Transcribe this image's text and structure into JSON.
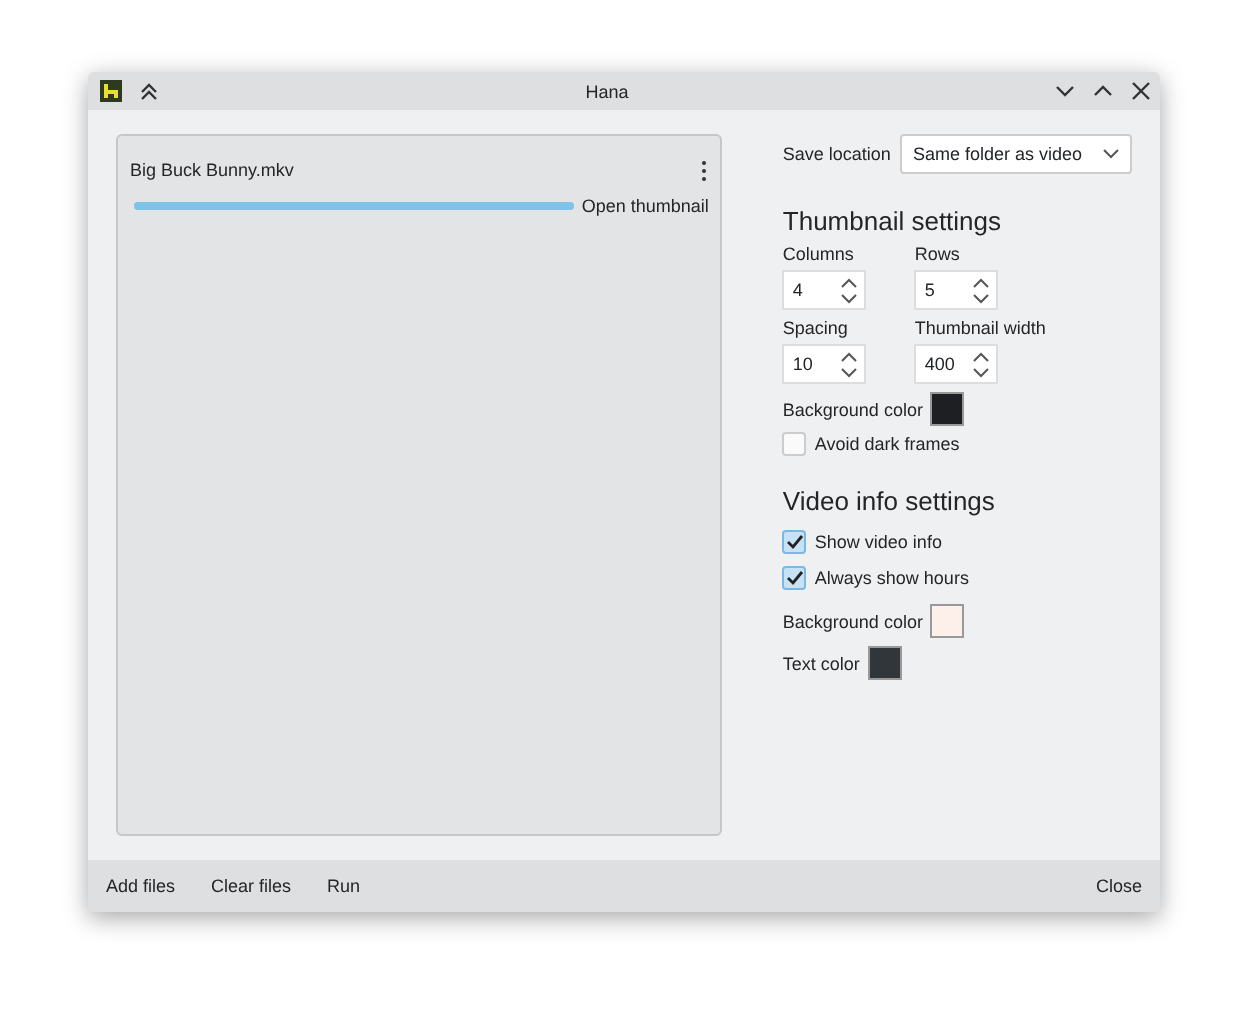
{
  "window": {
    "title": "Hana"
  },
  "files": [
    {
      "name": "Big Buck Bunny.mkv",
      "level": 1.0,
      "action": "Open thumbnail"
    }
  ],
  "save_location": {
    "label": "Save location",
    "value": "Same folder as video"
  },
  "thumbnail_settings": {
    "heading": "Thumbnail settings",
    "fields": [
      {
        "label": "Columns",
        "value": "4"
      },
      {
        "label": "Rows",
        "value": "5"
      },
      {
        "label": "Spacing",
        "value": "10"
      },
      {
        "label": "Thumbnail width",
        "value": "400"
      }
    ],
    "background": {
      "label": "Background color",
      "color": "#1e1f22"
    },
    "checks": [
      {
        "label": "Avoid dark frames",
        "checked": false
      }
    ]
  },
  "video_info_settings": {
    "heading": "Video info settings",
    "checks": [
      {
        "label": "Show video info",
        "checked": true
      },
      {
        "label": "Always show hours",
        "checked": true
      }
    ],
    "colors": [
      {
        "label": "Background color",
        "color": "#fdf0ea"
      },
      {
        "label": "Text color",
        "color": "#31363b"
      }
    ]
  },
  "footer": {
    "left_buttons": [
      "Add files",
      "Clear files",
      "Run"
    ],
    "right_button": "Close"
  }
}
